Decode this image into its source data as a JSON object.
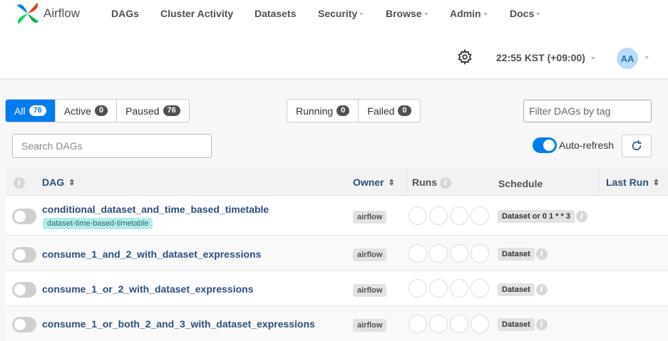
{
  "brand": {
    "name": "Airflow"
  },
  "nav": {
    "items": [
      {
        "label": "DAGs",
        "dropdown": false
      },
      {
        "label": "Cluster Activity",
        "dropdown": false
      },
      {
        "label": "Datasets",
        "dropdown": false
      },
      {
        "label": "Security",
        "dropdown": true
      },
      {
        "label": "Browse",
        "dropdown": true
      },
      {
        "label": "Admin",
        "dropdown": true
      },
      {
        "label": "Docs",
        "dropdown": true
      }
    ],
    "timezone": "22:55 KST (+09:00)",
    "user_initials": "AA"
  },
  "filters": {
    "status": [
      {
        "label": "All",
        "count": "76",
        "active": true
      },
      {
        "label": "Active",
        "count": "0",
        "active": false
      },
      {
        "label": "Paused",
        "count": "76",
        "active": false
      }
    ],
    "runs": [
      {
        "label": "Running",
        "count": "0"
      },
      {
        "label": "Failed",
        "count": "0"
      }
    ],
    "tag_placeholder": "Filter DAGs by tag",
    "search_placeholder": "Search DAGs",
    "auto_refresh_label": "Auto-refresh"
  },
  "table": {
    "headers": {
      "dag": "DAG",
      "owner": "Owner",
      "runs": "Runs",
      "schedule": "Schedule",
      "last_run": "Last Run"
    },
    "rows": [
      {
        "dag_id": "conditional_dataset_and_time_based_timetable",
        "tag": "dataset-time-based-timetable",
        "owner": "airflow",
        "schedule": "Dataset or 0 1 * * 3"
      },
      {
        "dag_id": "consume_1_and_2_with_dataset_expressions",
        "tag": "",
        "owner": "airflow",
        "schedule": "Dataset"
      },
      {
        "dag_id": "consume_1_or_2_with_dataset_expressions",
        "tag": "",
        "owner": "airflow",
        "schedule": "Dataset"
      },
      {
        "dag_id": "consume_1_or_both_2_and_3_with_dataset_expressions",
        "tag": "",
        "owner": "airflow",
        "schedule": "Dataset"
      }
    ]
  },
  "colors": {
    "accent": "#017cee",
    "link": "#2d4f7c",
    "tag_bg": "#b2ecea"
  },
  "icons": {
    "settings": "gear-icon",
    "refresh": "refresh-icon",
    "info": "info-icon",
    "sort": "sort-icon"
  }
}
